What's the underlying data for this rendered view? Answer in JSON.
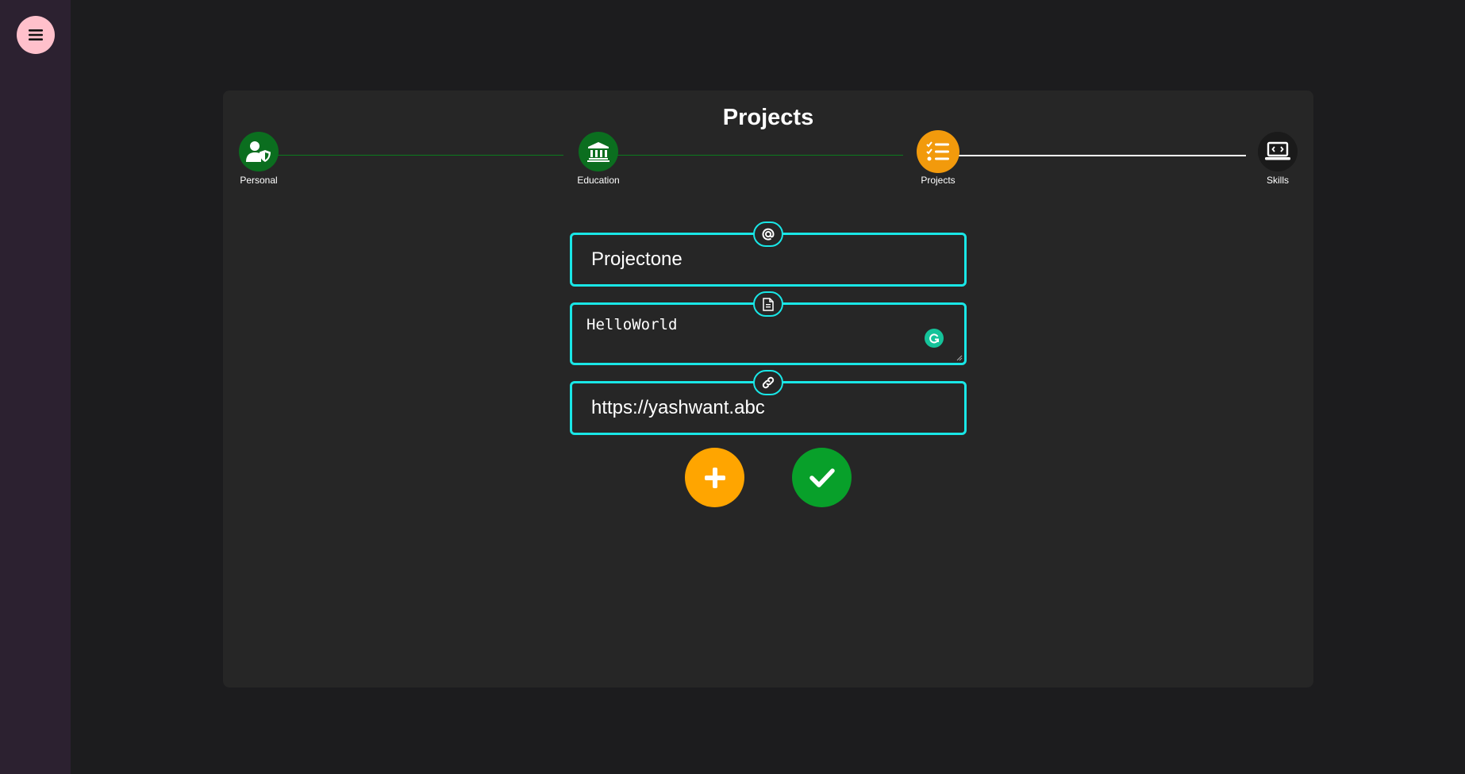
{
  "page": {
    "title": "Projects"
  },
  "sidebar": {
    "menu_icon": "hamburger-menu-icon"
  },
  "colors": {
    "complete": "#0b6e1f",
    "active": "#f29a0c",
    "pending": "#1a1a1a",
    "field_border": "#19e6e6",
    "add": "#ffa500",
    "submit": "#08a02a"
  },
  "steps": [
    {
      "label": "Personal",
      "icon": "user-shield-icon",
      "state": "complete"
    },
    {
      "label": "Education",
      "icon": "bank-icon",
      "state": "complete"
    },
    {
      "label": "Projects",
      "icon": "checklist-icon",
      "state": "active"
    },
    {
      "label": "Skills",
      "icon": "laptop-code-icon",
      "state": "pending"
    }
  ],
  "form": {
    "project_name": {
      "value": "Projectone",
      "icon": "at-icon"
    },
    "description": {
      "value": "HelloWorld",
      "icon": "document-icon"
    },
    "link": {
      "value": "https://yashwant.abc",
      "icon": "link-icon"
    }
  },
  "actions": {
    "add_icon": "plus-icon",
    "submit_icon": "check-icon"
  }
}
